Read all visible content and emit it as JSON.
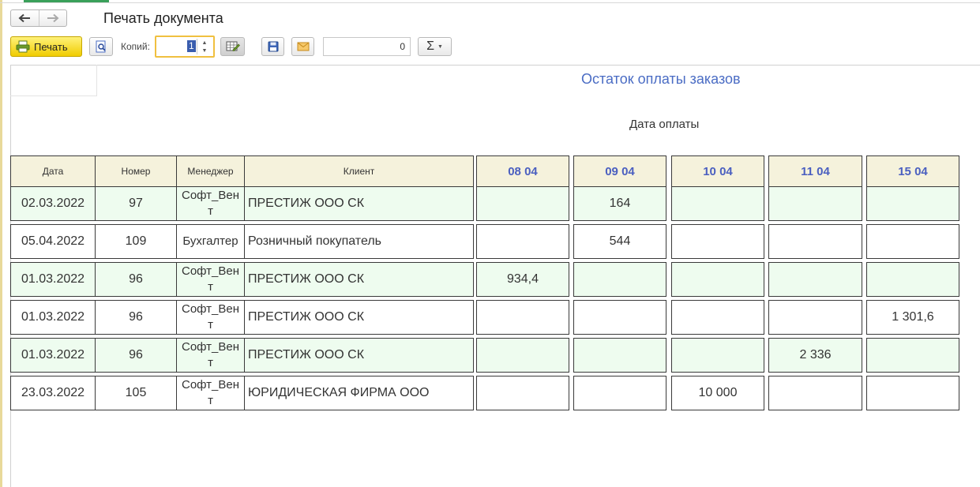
{
  "window": {
    "title": "Печать документа"
  },
  "toolbar": {
    "print_label": "Печать",
    "copies_label": "Копий:",
    "copies_value": "1",
    "number_value": "0",
    "sum_symbol": "Σ"
  },
  "icons": {
    "back": "arrow-left-icon",
    "forward": "arrow-right-icon",
    "print": "printer-icon",
    "preview": "magnifier-icon",
    "edit": "edit-table-icon",
    "save": "floppy-disk-icon",
    "mail": "envelope-icon"
  },
  "colors": {
    "accent_blue": "#4a6cc4",
    "row_green": "#eefcef",
    "header_bg": "#f5f2dc",
    "print_yellow": "#f5dc20"
  },
  "report": {
    "title": "Остаток оплаты заказов",
    "pay_date_label": "Дата оплаты",
    "columns": [
      "Дата",
      "Номер",
      "Менеджер",
      "Клиент"
    ],
    "date_columns": [
      "08 04",
      "09 04",
      "10 04",
      "11 04",
      "15 04"
    ],
    "rows": [
      {
        "date": "02.03.2022",
        "number": "97",
        "manager": "Софт_Вент",
        "client": "ПРЕСТИЖ ООО СК",
        "amounts": [
          "",
          "164",
          "",
          "",
          ""
        ]
      },
      {
        "date": "05.04.2022",
        "number": "109",
        "manager": "Бухгалтер",
        "client": "Розничный покупатель",
        "amounts": [
          "",
          "544",
          "",
          "",
          ""
        ]
      },
      {
        "date": "01.03.2022",
        "number": "96",
        "manager": "Софт_Вент",
        "client": "ПРЕСТИЖ ООО СК",
        "amounts": [
          "934,4",
          "",
          "",
          "",
          ""
        ]
      },
      {
        "date": "01.03.2022",
        "number": "96",
        "manager": "Софт_Вент",
        "client": "ПРЕСТИЖ ООО СК",
        "amounts": [
          "",
          "",
          "",
          "",
          "1 301,6"
        ]
      },
      {
        "date": "01.03.2022",
        "number": "96",
        "manager": "Софт_Вент",
        "client": "ПРЕСТИЖ ООО СК",
        "amounts": [
          "",
          "",
          "",
          "2 336",
          ""
        ]
      },
      {
        "date": "23.03.2022",
        "number": "105",
        "manager": "Софт_Вент",
        "client": "ЮРИДИЧЕСКАЯ ФИРМА ООО",
        "amounts": [
          "",
          "",
          "10 000",
          "",
          ""
        ]
      }
    ]
  }
}
